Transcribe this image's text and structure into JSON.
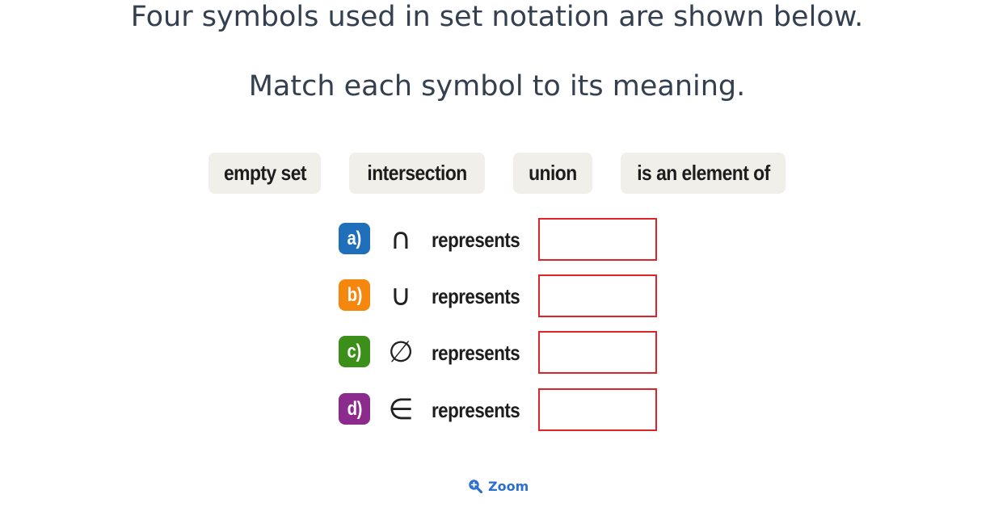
{
  "heading": {
    "line1": "Four symbols used in set notation are shown below.",
    "line2": "Match each symbol to its meaning."
  },
  "options": [
    {
      "label": "empty set"
    },
    {
      "label": "intersection"
    },
    {
      "label": "union"
    },
    {
      "label": "is an element of"
    }
  ],
  "questions": [
    {
      "letter": "a)",
      "symbol": "∩",
      "text": "represents",
      "color": "#1f6fba"
    },
    {
      "letter": "b)",
      "symbol": "∪",
      "text": "represents",
      "color": "#f5870f"
    },
    {
      "letter": "c)",
      "symbol": "∅",
      "text": "represents",
      "color": "#3c8f18"
    },
    {
      "letter": "d)",
      "symbol": "∈",
      "text": "represents",
      "color": "#8c2a8e"
    }
  ],
  "answer_box_border": "#e0222a",
  "zoom": {
    "label": "Zoom",
    "icon": "zoom-in-icon",
    "color": "#2c6fd1"
  }
}
